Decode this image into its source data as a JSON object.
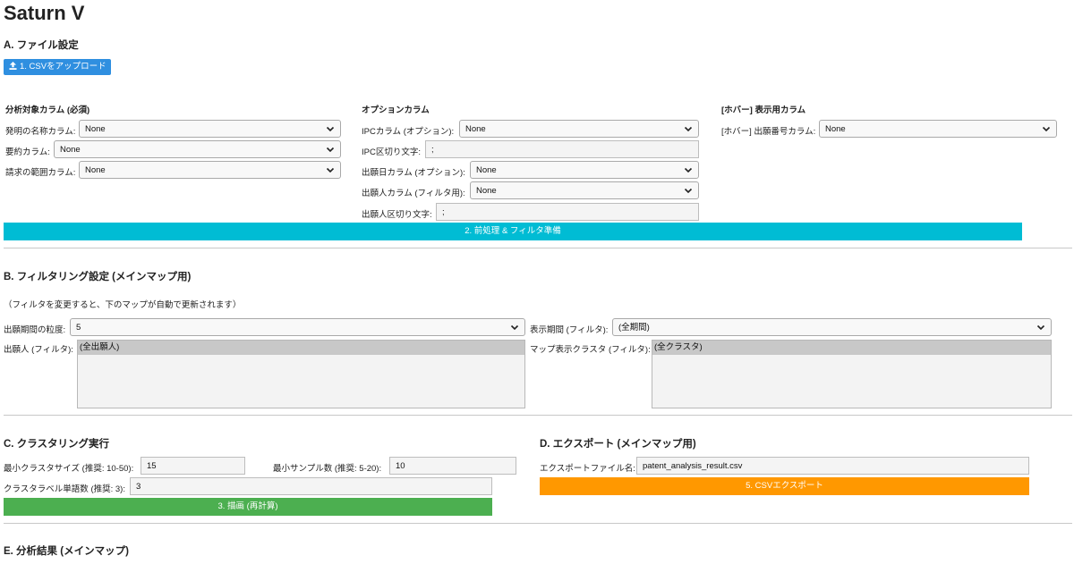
{
  "app_title": "Saturn V",
  "sectionA": {
    "heading": "A. ファイル設定",
    "upload_label": "1. CSVをアップロード",
    "col1": {
      "heading": "分析対象カラム (必須)",
      "fields": [
        {
          "label": "発明の名称カラム:",
          "value": "None"
        },
        {
          "label": "要約カラム:",
          "value": "None"
        },
        {
          "label": "請求の範囲カラム:",
          "value": "None"
        }
      ]
    },
    "col2": {
      "heading": "オプションカラム",
      "ipc_label": "IPCカラム (オプション):",
      "ipc_value": "None",
      "ipc_sep_label": "IPC区切り文字:",
      "ipc_sep_value": ";",
      "date_label": "出願日カラム (オプション):",
      "date_value": "None",
      "applicant_label": "出願人カラム (フィルタ用):",
      "applicant_value": "None",
      "applicant_sep_label": "出願人区切り文字:",
      "applicant_sep_value": ";"
    },
    "col3": {
      "heading": "[ホバー] 表示用カラム",
      "number_label": "[ホバー] 出願番号カラム:",
      "number_value": "None"
    },
    "preprocess_label": "2. 前処理 & フィルタ準備"
  },
  "sectionB": {
    "heading": "B. フィルタリング設定 (メインマップ用)",
    "note": "（フィルタを変更すると、下のマップが自動で更新されます）",
    "granularity_label": "出願期間の粒度:",
    "granularity_value": "5",
    "period_label": "表示期間 (フィルタ):",
    "period_value": "(全期間)",
    "applicant_label": "出願人 (フィルタ):",
    "applicant_option": "(全出願人)",
    "cluster_label": "マップ表示クラスタ (フィルタ):",
    "cluster_option": "(全クラスタ)"
  },
  "sectionC": {
    "heading": "C. クラスタリング実行",
    "min_cluster_label": "最小クラスタサイズ (推奨: 10-50):",
    "min_cluster_value": "15",
    "min_sample_label": "最小サンプル数 (推奨: 5-20):",
    "min_sample_value": "10",
    "label_words_label": "クラスタラベル単語数 (推奨: 3):",
    "label_words_value": "3",
    "draw_label": "3. 描画 (再計算)"
  },
  "sectionD": {
    "heading": "D. エクスポート (メインマップ用)",
    "filename_label": "エクスポートファイル名:",
    "filename_value": "patent_analysis_result.csv",
    "export_label": "5. CSVエクスポート"
  },
  "sectionE": {
    "heading": "E. 分析結果 (メインマップ)"
  },
  "colors": {
    "upload": "#2f8fe0",
    "preprocess": "#00bcd4",
    "draw": "#4caf50",
    "export": "#ff9800"
  }
}
